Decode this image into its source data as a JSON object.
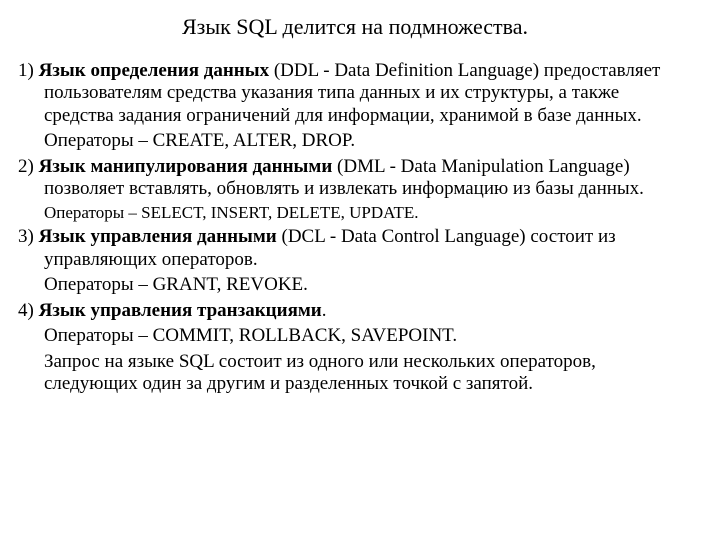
{
  "title": "Язык SQL делится на подмножества.",
  "items": [
    {
      "num": "1) ",
      "bold": "Язык определения данных",
      "rest": " (DDL - Data Definition Language) предоставляет пользователям средства указания типа данных и их структуры, а также средства задания ограничений для информации, хранимой в базе данных.",
      "ops": "Операторы – CREATE, ALTER, DROP.",
      "ops_small": false
    },
    {
      "num": "2) ",
      "bold": "Язык манипулирования данными",
      "rest": " (DML - Data Manipulation Language) позволяет вставлять, обновлять и извлекать информацию из базы данных.",
      "ops": "Операторы – SELECT, INSERT, DELETE, UPDATE.",
      "ops_small": true
    },
    {
      "num": "3) ",
      "bold": "Язык управления данными",
      "rest": " (DCL - Data Control Language) состоит из управляющих операторов.",
      "ops": "Операторы – GRANT, REVOKE.",
      "ops_small": false
    },
    {
      "num": "4) ",
      "bold": "Язык управления транзакциями",
      "rest": ".",
      "ops": "Операторы – COMMIT, ROLLBACK, SAVEPOINT.",
      "ops_small": false
    }
  ],
  "footer": "Запрос на языке SQL состоит из одного или нескольких операторов, следующих один за другим и разделенных точкой с запятой."
}
